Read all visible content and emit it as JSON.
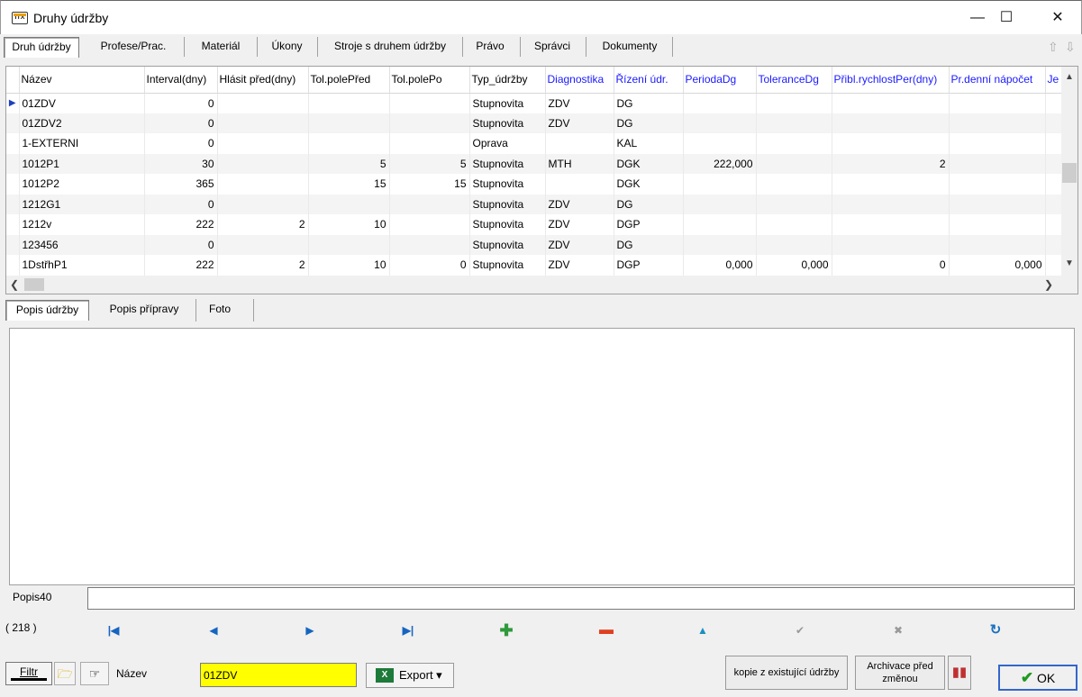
{
  "window": {
    "title": "Druhy údržby",
    "min": "—",
    "max": "☐",
    "close": "✕"
  },
  "tabs_top": [
    "Druh údržby",
    "Profese/Prac.",
    "Materiál",
    "Úkony",
    "Stroje s druhem údržby",
    "Právo",
    "Správci",
    "Dokumenty"
  ],
  "grid": {
    "columns": [
      "Název",
      "Interval(dny)",
      "Hlásit před(dny)",
      "Tol.polePřed",
      "Tol.polePo",
      "Typ_údržby",
      "Diagnostika",
      "Řízení údr.",
      "PeriodaDg",
      "ToleranceDg",
      "Přibl.rychlostPer(dny)",
      "Pr.denní nápočet",
      "Je"
    ],
    "rows": [
      [
        "01ZDV",
        "0",
        "",
        "",
        "",
        "Stupnovita",
        "ZDV",
        "DG",
        "",
        "",
        "",
        "",
        ""
      ],
      [
        "01ZDV2",
        "0",
        "",
        "",
        "",
        "Stupnovita",
        "ZDV",
        "DG",
        "",
        "",
        "",
        "",
        ""
      ],
      [
        "1-EXTERNI",
        "0",
        "",
        "",
        "",
        "Oprava",
        "",
        "KAL",
        "",
        "",
        "",
        "",
        ""
      ],
      [
        "1012P1",
        "30",
        "",
        "5",
        "5",
        "Stupnovita",
        "MTH",
        "DGK",
        "222,000",
        "",
        "2",
        "",
        ""
      ],
      [
        "1012P2",
        "365",
        "",
        "15",
        "15",
        "Stupnovita",
        "",
        "DGK",
        "",
        "",
        "",
        "",
        ""
      ],
      [
        "1212G1",
        "0",
        "",
        "",
        "",
        "Stupnovita",
        "ZDV",
        "DG",
        "",
        "",
        "",
        "",
        ""
      ],
      [
        "1212v",
        "222",
        "2",
        "10",
        "",
        "Stupnovita",
        "ZDV",
        "DGP",
        "",
        "",
        "",
        "",
        ""
      ],
      [
        "123456",
        "0",
        "",
        "",
        "",
        "Stupnovita",
        "ZDV",
        "DG",
        "",
        "",
        "",
        "",
        ""
      ],
      [
        "1DstřhP1",
        "222",
        "2",
        "10",
        "0",
        "Stupnovita",
        "ZDV",
        "DGP",
        "0,000",
        "0,000",
        "0",
        "0,000",
        ""
      ]
    ]
  },
  "tabs_bottom": [
    "Popis údržby",
    "Popis přípravy",
    "Foto"
  ],
  "popis40": {
    "label": "Popis40",
    "value": ""
  },
  "record_count": "( 218 )",
  "filter": {
    "label": "Filtr",
    "field_label": "Název",
    "field_value": "01ZDV"
  },
  "buttons": {
    "export": "Export ▾",
    "kopie": "kopie z existující údržby",
    "archivace_1": "Archivace před",
    "archivace_2": "změnou",
    "ok": "OK"
  }
}
